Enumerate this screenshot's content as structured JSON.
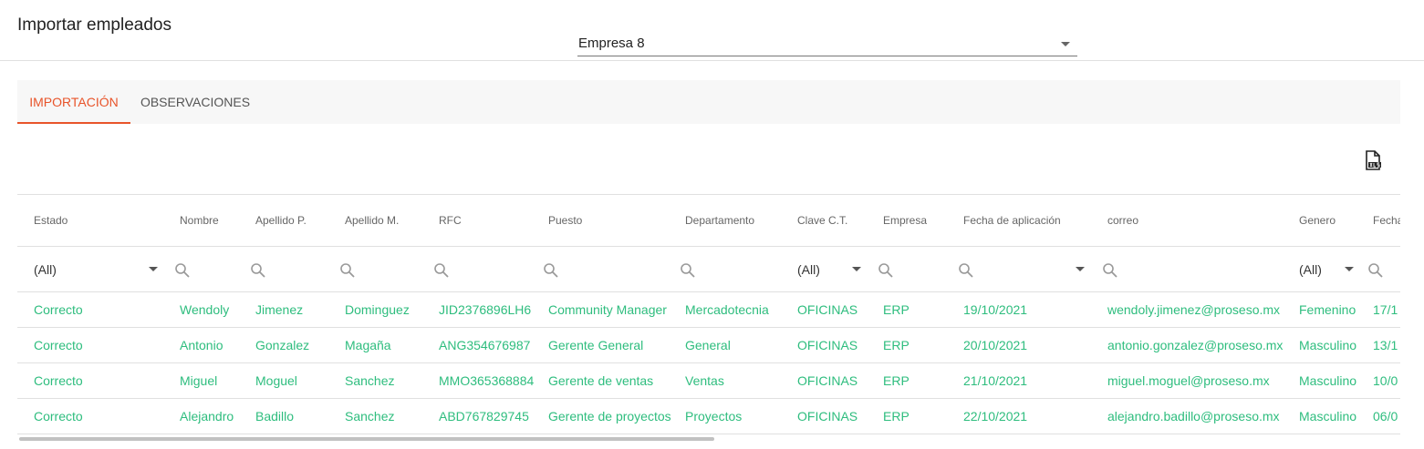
{
  "header": {
    "title": "Importar empleados"
  },
  "company_select": {
    "value": "Empresa 8"
  },
  "tabs": [
    {
      "label": "IMPORTACIÓN",
      "active": true
    },
    {
      "label": "OBSERVACIONES",
      "active": false
    }
  ],
  "export": {
    "icon": "xlsx-file-icon"
  },
  "grid": {
    "columns": [
      "Estado",
      "Nombre",
      "Apellido P.",
      "Apellido M.",
      "RFC",
      "Puesto",
      "Departamento",
      "Clave C.T.",
      "Empresa",
      "Fecha de aplicación",
      "correo",
      "Genero",
      "Fecha"
    ],
    "filters": {
      "estado": "(All)",
      "clave_ct": "(All)",
      "genero": "(All)"
    },
    "rows": [
      [
        "Correcto",
        "Wendoly",
        "Jimenez",
        "Dominguez",
        "JID2376896LH6",
        "Community Manager",
        "Mercadotecnia",
        "OFICINAS",
        "ERP",
        "19/10/2021",
        "wendoly.jimenez@proseso.mx",
        "Femenino",
        "17/1"
      ],
      [
        "Correcto",
        "Antonio",
        "Gonzalez",
        "Magaña",
        "ANG354676987",
        "Gerente General",
        "General",
        "OFICINAS",
        "ERP",
        "20/10/2021",
        "antonio.gonzalez@proseso.mx",
        "Masculino",
        "13/1"
      ],
      [
        "Correcto",
        "Miguel",
        "Moguel",
        "Sanchez",
        "MMO365368884",
        "Gerente de ventas",
        "Ventas",
        "OFICINAS",
        "ERP",
        "21/10/2021",
        "miguel.moguel@proseso.mx",
        "Masculino",
        "10/0"
      ],
      [
        "Correcto",
        "Alejandro",
        "Badillo",
        "Sanchez",
        "ABD767829745",
        "Gerente de proyectos",
        "Proyectos",
        "OFICINAS",
        "ERP",
        "22/10/2021",
        "alejandro.badillo@proseso.mx",
        "Masculino",
        "06/0"
      ]
    ]
  },
  "colors": {
    "accent": "#e8542a",
    "success_text": "#2ebd7e"
  }
}
